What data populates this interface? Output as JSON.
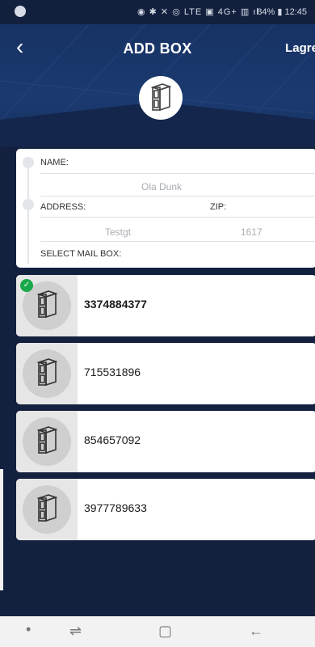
{
  "status_bar": {
    "icons": "◉ ✱ ✕ ◎ LTE ▣ 4G+ ▥ ıl",
    "battery": "84%",
    "time": "12:45"
  },
  "header": {
    "back_icon": "‹",
    "title": "ADD BOX",
    "save_label": "Lagre"
  },
  "form": {
    "name_label": "NAME:",
    "name_value": "Ola Dunk",
    "address_label": "ADDRESS:",
    "address_value": "Testgt",
    "zip_label": "ZIP:",
    "zip_value": "1617",
    "select_label": "SELECT MAIL BOX:"
  },
  "mailboxes": [
    {
      "number": "3374884377",
      "selected": true
    },
    {
      "number": "715531896",
      "selected": false
    },
    {
      "number": "854657092",
      "selected": false
    },
    {
      "number": "3977789633",
      "selected": false
    }
  ],
  "nav": {
    "dot": "•",
    "recent_icon": "⇌",
    "home_icon": "▢",
    "back_icon": "←"
  },
  "colors": {
    "header_bg": "#173264",
    "page_bg": "#13213f",
    "check_green": "#19a84a"
  }
}
